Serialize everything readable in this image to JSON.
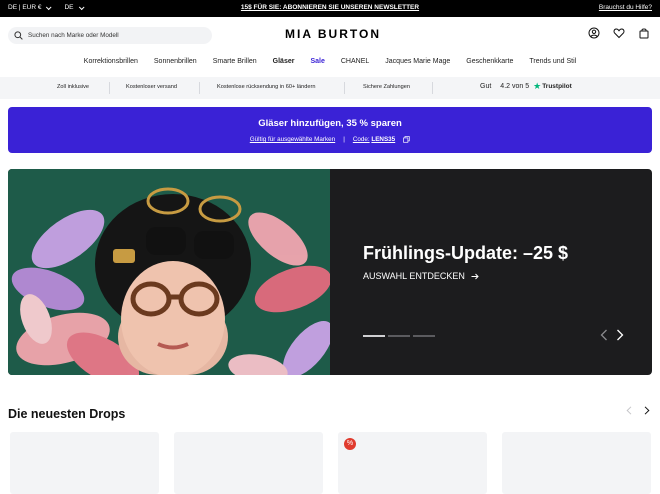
{
  "topbar": {
    "locale": "DE | EUR €",
    "language": "DE",
    "promo": "15$ FÜR SIE: ABONNIEREN SIE UNSEREN NEWSLETTER",
    "help": "Brauchst du Hilfe?"
  },
  "header": {
    "search_placeholder": "Suchen nach Marke oder Modell",
    "logo": "MIA BURTON",
    "icons": [
      "search-icon",
      "account-icon",
      "wishlist-icon",
      "bag-icon"
    ]
  },
  "nav": {
    "items": [
      {
        "label": "Korrektionsbrillen"
      },
      {
        "label": "Sonnenbrillen"
      },
      {
        "label": "Smarte Brillen"
      },
      {
        "label": "Gläser"
      },
      {
        "label": "Sale"
      },
      {
        "label": "CHANEL"
      },
      {
        "label": "Jacques Marie Mage"
      },
      {
        "label": "Geschenkkarte"
      },
      {
        "label": "Trends und Stil"
      }
    ]
  },
  "usp": {
    "items": [
      "Zoll inklusive",
      "Kostenloser versand",
      "Kostenlose rücksendung in 60+ ländern",
      "Sichere Zahlungen"
    ],
    "rating_label": "Gut",
    "rating_value": "4.2 von 5",
    "trustpilot": "Trustpilot"
  },
  "promo_banner": {
    "title": "Gläser hinzufügen, 35 % sparen",
    "valid": "Gültig für ausgewählte Marken",
    "separator": "|",
    "code_label": "Code:",
    "code": "LENS35"
  },
  "hero": {
    "headline": "Frühlings-Update: –25 $",
    "cta": "AUSWAHL ENTDECKEN",
    "slides": 3,
    "active_slide": 1
  },
  "drops": {
    "title": "Die neuesten Drops",
    "badge_icon": "discount-icon"
  },
  "colors": {
    "accent": "#3a22d6",
    "hero_bg": "#1c1c1e",
    "hero_image_bg": "#1e5b49",
    "badge": "#e03b2e",
    "trustpilot_green": "#00b67a"
  }
}
